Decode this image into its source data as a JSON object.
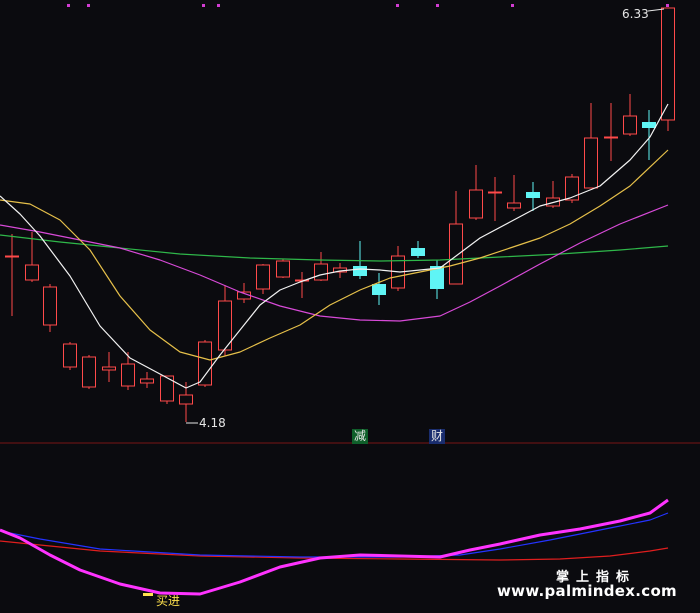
{
  "chart_data": {
    "type": "candlestick",
    "price_high_label": "6.33",
    "price_low_label": "4.18",
    "markers": {
      "reduce": "减",
      "wealth": "财",
      "buy": "买进"
    },
    "colors": {
      "up": "#ff4a4a",
      "down": "#5ff5f5",
      "ma5": "#f2f2f2",
      "ma10": "#e6c04a",
      "ma20": "#d84ad8",
      "ma60": "#2fb84a",
      "ind1": "#ff33ff",
      "ind2": "#2433ff",
      "ind3": "#e01e1e"
    }
  },
  "watermark": {
    "cn": "掌上指标",
    "url": "www.palmindex.com"
  }
}
